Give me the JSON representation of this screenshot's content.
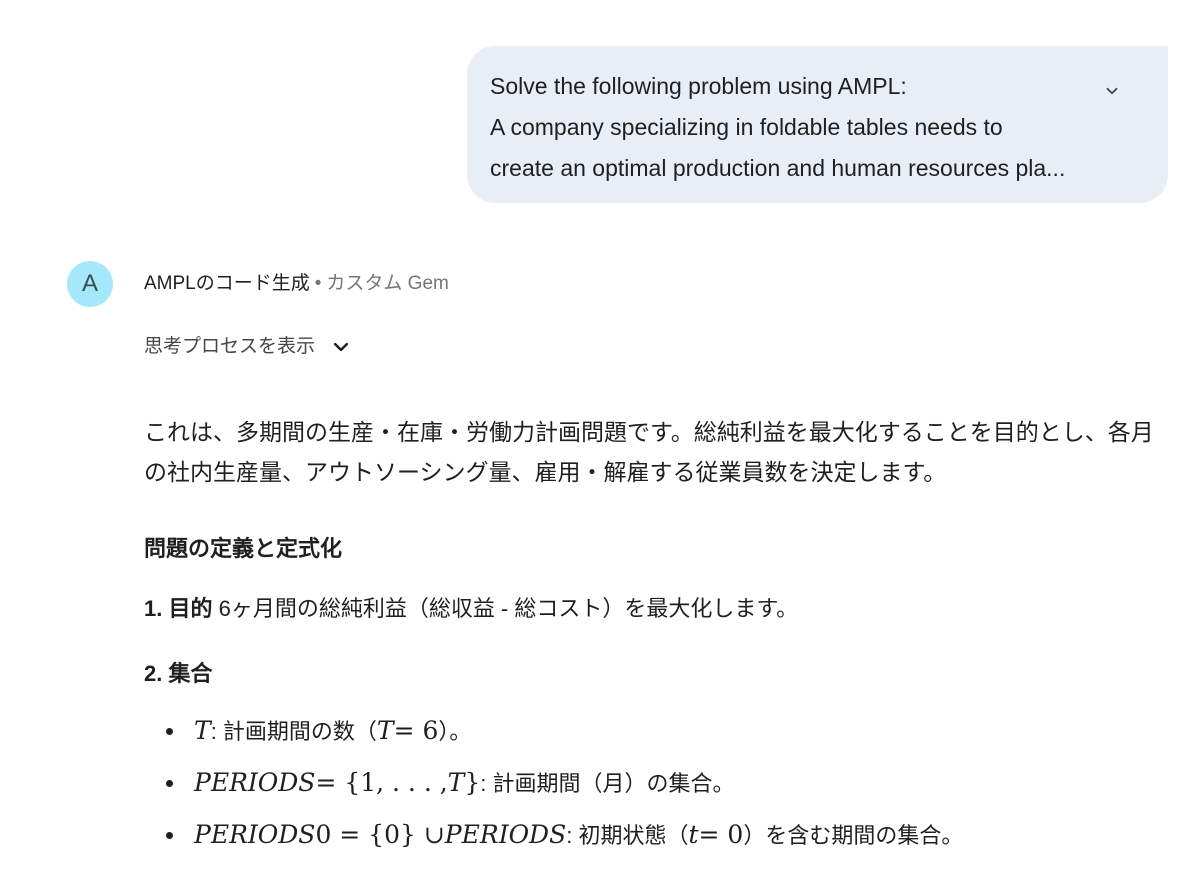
{
  "user_prompt": {
    "line1": "Solve the following problem using AMPL:",
    "line2": "A company specializing in foldable tables needs to",
    "line3": "create an optimal production and human resources pla..."
  },
  "response_header": {
    "avatar_letter": "A",
    "gem_name": "AMPLのコード生成",
    "separator": "•",
    "gem_type": "カスタム Gem"
  },
  "thinking_toggle": {
    "label": "思考プロセスを表示"
  },
  "response": {
    "intro": "これは、多期間の生産・在庫・労働力計画問題です。総純利益を最大化することを目的とし、各月の社内生産量、アウトソーシング量、雇用・解雇する従業員数を決定します。",
    "section_title": "問題の定義と定式化",
    "objective": {
      "label": "1. 目的",
      "text": " 6ヶ月間の総純利益（総収益 - 総コスト）を最大化します。"
    },
    "sets_title": "2. 集合",
    "sets": [
      {
        "math1": "T",
        "text1": ": 計画期間の数（",
        "math2": "T",
        "math3": " = 6",
        "text2": "）。"
      },
      {
        "math1": "PERIODS",
        "math2": " = {1, . . . , ",
        "math3": "T",
        "math4": "}",
        "text1": ": 計画期間（月）の集合。"
      },
      {
        "math1": "PERIODS",
        "math2": "0 = {0} ∪ ",
        "math3": "PERIODS",
        "text1": ": 初期状態（",
        "math4": "t",
        "math5": " = 0",
        "text2": "）を含む期間の集合。"
      }
    ]
  }
}
